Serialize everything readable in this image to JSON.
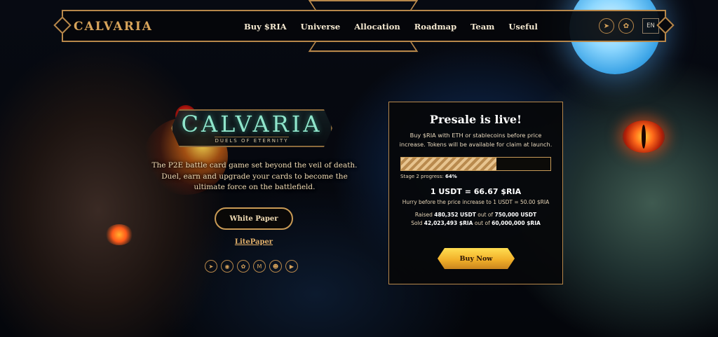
{
  "header": {
    "logo_text": "CALVARIA",
    "nav": [
      "Buy $RIA",
      "Universe",
      "Allocation",
      "Roadmap",
      "Team",
      "Useful"
    ],
    "social_icons": [
      "telegram-icon",
      "twitter-icon"
    ],
    "language": "EN"
  },
  "hero": {
    "logo_title": "CALVARIA",
    "logo_subtitle": "DUELS OF ETERNITY",
    "tagline": "The P2E battle card game set beyond the veil of death. Duel, earn and upgrade your cards to become the ultimate force on the battlefield.",
    "white_paper_label": "White Paper",
    "litepaper_label": "LitePaper",
    "social_icons": [
      "telegram-icon",
      "discord-icon",
      "twitter-icon",
      "medium-icon",
      "reddit-icon",
      "youtube-icon"
    ]
  },
  "presale": {
    "title": "Presale is live!",
    "description": "Buy $RIA with ETH or stablecoins before price increase. Tokens will be available for claim at launch.",
    "progress_fraction": 0.64,
    "stage_label": "Stage 2 progress:",
    "stage_value": "64%",
    "price": "1 USDT = 66.67 $RIA",
    "hurry_text": "Hurry before the price increase to 1 USDT = 50.00 $RIA",
    "raised_prefix": "Raised",
    "raised_value": "480,352 USDT",
    "raised_mid": "out of",
    "raised_target": "750,000 USDT",
    "sold_prefix": "Sold",
    "sold_value": "42,023,493 $RIA",
    "sold_mid": "out of",
    "sold_target": "60,000,000 $RIA",
    "buy_label": "Buy Now"
  },
  "colors": {
    "accent_gold": "#b7874a",
    "button_yellow": "#f2b12a",
    "logo_teal": "#8fe5cb"
  }
}
